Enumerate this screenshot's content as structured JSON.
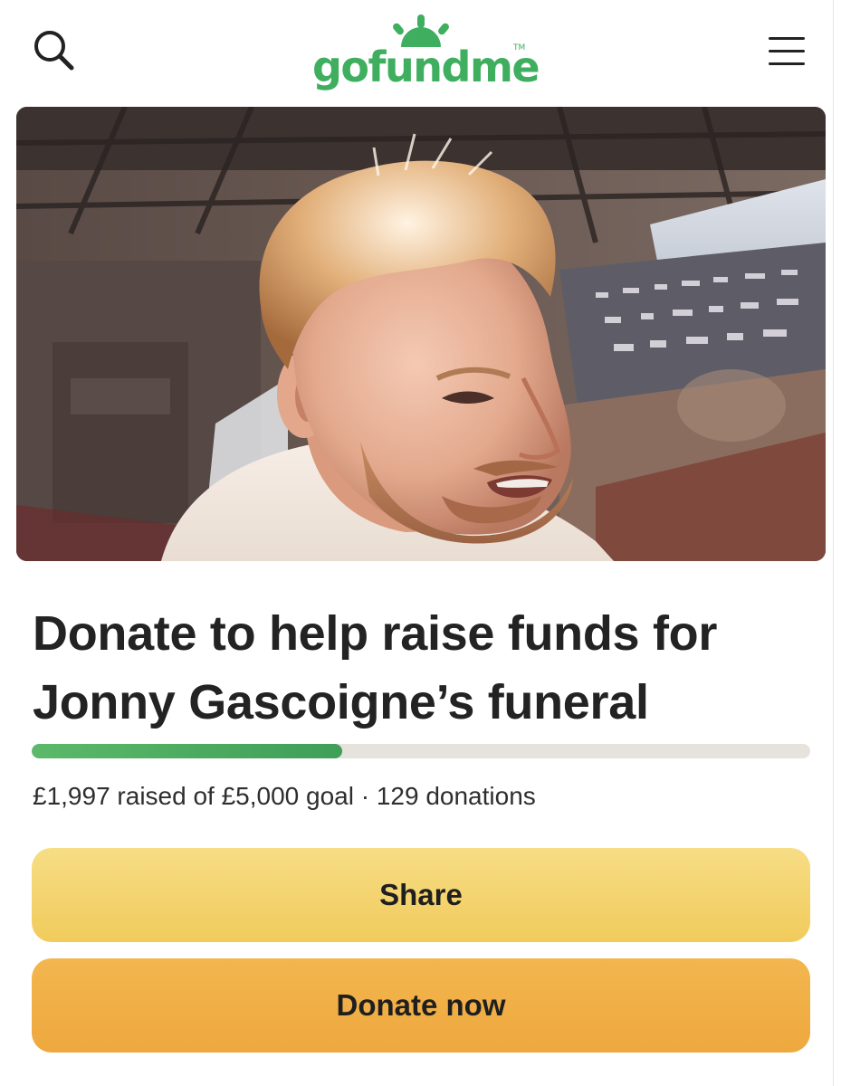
{
  "header": {
    "logo_text": "gofundme",
    "logo_tm": "TM",
    "search_icon": "search-icon",
    "menu_icon": "hamburger-menu-icon"
  },
  "campaign": {
    "title": "Donate to help raise funds for Jonny Gascoigne’s funeral",
    "progress_fraction": 0.3994,
    "stats_text": "£1,997 raised of £5,000 goal · 129 donations"
  },
  "actions": {
    "share_label": "Share",
    "donate_label": "Donate now"
  },
  "colors": {
    "brand_green": "#3fae5f",
    "share_yellow": "#f4d36e",
    "donate_orange": "#f0ad45",
    "progress_track": "#e6e3dc"
  }
}
